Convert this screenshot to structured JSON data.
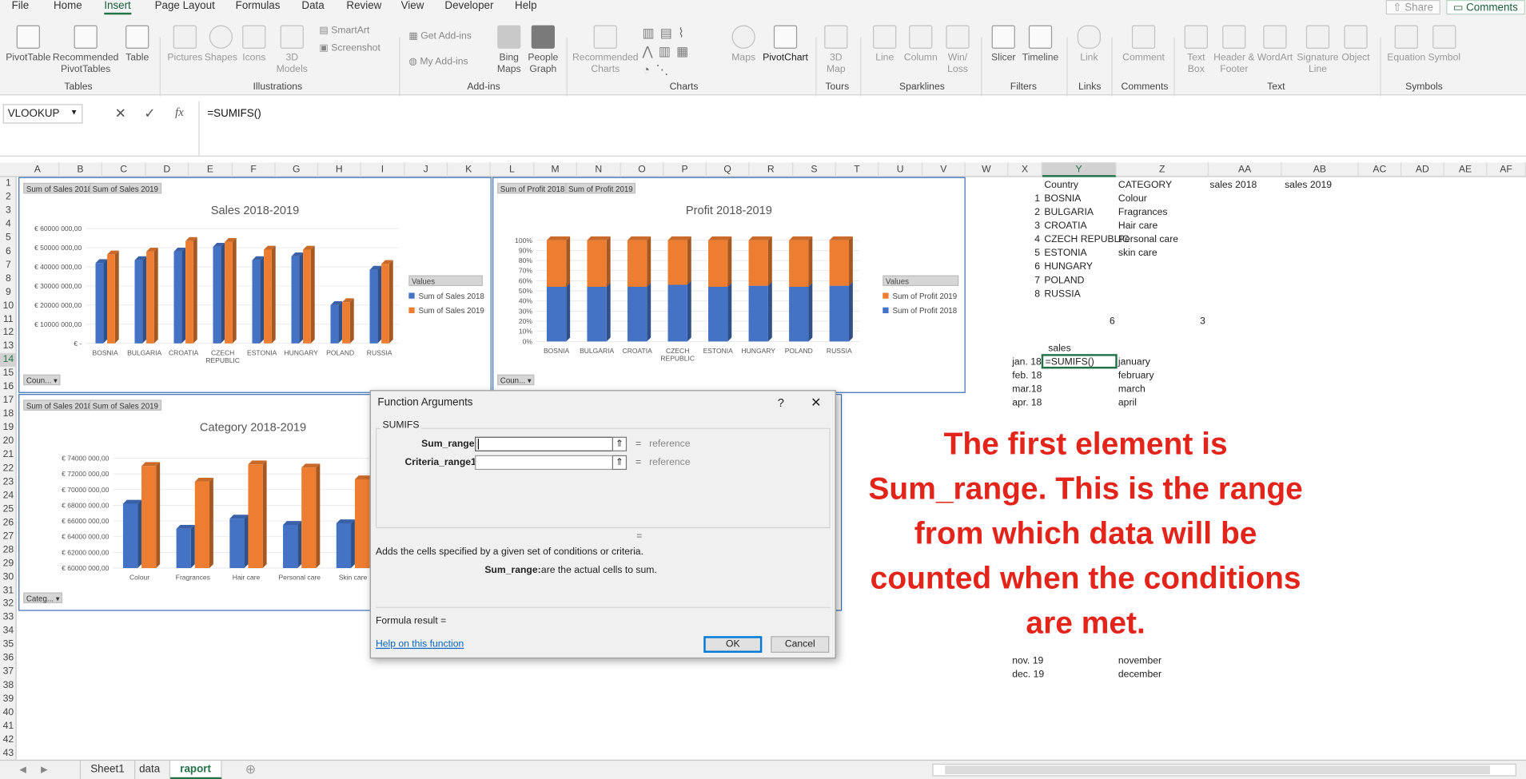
{
  "ribbon": {
    "tabs": [
      "File",
      "Home",
      "Insert",
      "Page Layout",
      "Formulas",
      "Data",
      "Review",
      "View",
      "Developer",
      "Help"
    ],
    "active_tab": "Insert",
    "share": "Share",
    "comments": "Comments",
    "buttons": {
      "pivottable": "PivotTable",
      "recommended_pivot": "Recommended PivotTables",
      "table": "Table",
      "pictures": "Pictures",
      "shapes": "Shapes",
      "icons": "Icons",
      "models_3d": "3D Models",
      "smartart": "SmartArt",
      "screenshot": "Screenshot",
      "get_addins": "Get Add-ins",
      "my_addins": "My Add-ins",
      "bing_maps": "Bing Maps",
      "people_graph": "People Graph",
      "recommended_charts": "Recommended Charts",
      "maps": "Maps",
      "pivotchart": "PivotChart",
      "map_3d": "3D Map",
      "line": "Line",
      "column": "Column",
      "winloss": "Win/ Loss",
      "slicer": "Slicer",
      "timeline": "Timeline",
      "link": "Link",
      "comment": "Comment",
      "textbox": "Text Box",
      "header_footer": "Header & Footer",
      "wordart": "WordArt",
      "signature": "Signature Line",
      "object": "Object",
      "equation": "Equation",
      "symbol": "Symbol"
    },
    "groups": [
      "Tables",
      "Illustrations",
      "Add-ins",
      "Charts",
      "Tours",
      "Sparklines",
      "Filters",
      "Links",
      "Comments",
      "Text",
      "Symbols"
    ]
  },
  "formula_bar": {
    "name_box": "VLOOKUP",
    "formula": "=SUMIFS()"
  },
  "columns": [
    "A",
    "B",
    "C",
    "D",
    "E",
    "F",
    "G",
    "H",
    "I",
    "J",
    "K",
    "L",
    "M",
    "N",
    "O",
    "P",
    "Q",
    "R",
    "S",
    "T",
    "U",
    "V",
    "W",
    "X",
    "Y",
    "Z",
    "AA",
    "AB",
    "AC",
    "AD",
    "AE",
    "AF"
  ],
  "rows": [
    "1",
    "2",
    "3",
    "4",
    "5",
    "6",
    "7",
    "8",
    "9",
    "10",
    "11",
    "12",
    "13",
    "14",
    "15",
    "16",
    "17",
    "18",
    "19",
    "20",
    "21",
    "22",
    "23",
    "24",
    "25",
    "26",
    "27",
    "28",
    "29",
    "30",
    "31",
    "32",
    "33",
    "34",
    "35",
    "36",
    "37",
    "38",
    "39",
    "40",
    "41",
    "42",
    "43"
  ],
  "sheet": {
    "header_country": "Country",
    "header_category": "CATEGORY",
    "header_sales2018": "sales 2018",
    "header_sales2019": "sales 2019",
    "numbers": [
      "1",
      "2",
      "3",
      "4",
      "5",
      "6",
      "7",
      "8"
    ],
    "countries": [
      "BOSNIA",
      "BULGARIA",
      "CROATIA",
      "CZECH REPUBLIC",
      "ESTONIA",
      "HUNGARY",
      "POLAND",
      "RUSSIA"
    ],
    "categories": [
      "Colour",
      "Fragrances",
      "Hair care",
      "Personal care",
      "skin care"
    ],
    "count_left": "6",
    "count_right": "3",
    "sales_label": "sales",
    "dates": [
      "jan. 18",
      "feb. 18",
      "mar.18",
      "apr. 18"
    ],
    "months": [
      "january",
      "february",
      "march",
      "april"
    ],
    "active_cell": "=SUMIFS()",
    "dates_bottom": [
      "nov. 19",
      "dec. 19"
    ],
    "months_bottom": [
      "november",
      "december"
    ]
  },
  "charts": {
    "sales": {
      "btn1": "Sum of Sales 2018",
      "btn2": "Sum of Sales 2019",
      "title": "Sales 2018-2019",
      "legend_title": "Values",
      "legend": [
        "Sum of Sales 2018",
        "Sum of Sales 2019"
      ],
      "filter": "Coun..."
    },
    "profit": {
      "btn1": "Sum of Profit 2018",
      "btn2": "Sum of Profit 2019",
      "title": "Profit 2018-2019",
      "legend_title": "Values",
      "legend": [
        "Sum of Profit 2019",
        "Sum of Profit 2018"
      ],
      "filter": "Coun..."
    },
    "category": {
      "btn1": "Sum of Sales 2018",
      "btn2": "Sum of Sales 2019",
      "title": "Category 2018-2019",
      "filter": "Categ..."
    }
  },
  "chart_data": [
    {
      "type": "bar",
      "title": "Sales 2018-2019",
      "categories": [
        "BOSNIA",
        "BULGARIA",
        "CROATIA",
        "CZECH REPUBLIC",
        "ESTONIA",
        "HUNGARY",
        "POLAND",
        "RUSSIA"
      ],
      "series": [
        {
          "name": "Sum of Sales 2018",
          "values": [
            42000000,
            43500000,
            48000000,
            50500000,
            43500000,
            45500000,
            20000000,
            38500000
          ]
        },
        {
          "name": "Sum of Sales 2019",
          "values": [
            46500000,
            48000000,
            53500000,
            53000000,
            49000000,
            49000000,
            21500000,
            41500000
          ]
        }
      ],
      "yticks": [
        "€ 60000 000,00",
        "€ 50000 000,00",
        "€ 40000 000,00",
        "€ 30000 000,00",
        "€ 20000 000,00",
        "€ 10000 000,00",
        "€ -"
      ],
      "ylim": [
        0,
        60000000
      ],
      "legend_position": "right",
      "colors": [
        "#4472c4",
        "#ed7d31"
      ]
    },
    {
      "type": "bar",
      "title": "Profit 2018-2019",
      "categories": [
        "BOSNIA",
        "BULGARIA",
        "CROATIA",
        "CZECH REPUBLIC",
        "ESTONIA",
        "HUNGARY",
        "POLAND",
        "RUSSIA"
      ],
      "stacked_percent": true,
      "series": [
        {
          "name": "Sum of Profit 2018",
          "values": [
            54,
            54,
            54,
            56,
            54,
            55,
            54,
            55
          ]
        },
        {
          "name": "Sum of Profit 2019",
          "values": [
            46,
            46,
            46,
            44,
            46,
            45,
            46,
            45
          ]
        }
      ],
      "yticks": [
        "100%",
        "90%",
        "80%",
        "70%",
        "60%",
        "50%",
        "40%",
        "30%",
        "20%",
        "10%",
        "0%"
      ],
      "ylim": [
        0,
        100
      ],
      "legend_position": "right",
      "colors": [
        "#4472c4",
        "#ed7d31"
      ]
    },
    {
      "type": "bar",
      "title": "Category 2018-2019",
      "categories": [
        "Colour",
        "Fragrances",
        "Hair care",
        "Personal care",
        "Skin care"
      ],
      "series": [
        {
          "name": "Sum of Sales 2018",
          "values": [
            68200000,
            65000000,
            66300000,
            65500000,
            65700000
          ]
        },
        {
          "name": "Sum of Sales 2019",
          "values": [
            73000000,
            71000000,
            73200000,
            72800000,
            71300000
          ]
        }
      ],
      "yticks": [
        "€ 74000 000,00",
        "€ 72000 000,00",
        "€ 70000 000,00",
        "€ 68000 000,00",
        "€ 66000 000,00",
        "€ 64000 000,00",
        "€ 62000 000,00",
        "€ 60000 000,00"
      ],
      "ylim": [
        60000000,
        74000000
      ],
      "colors": [
        "#4472c4",
        "#ed7d31"
      ]
    }
  ],
  "dialog": {
    "title": "Function Arguments",
    "help": "?",
    "close": "✕",
    "function_name": "SUMIFS",
    "arg1_label": "Sum_range",
    "arg2_label": "Criteria_range1",
    "eq": "=",
    "ref1": "reference",
    "ref2": "reference",
    "eq_mid": "=",
    "description": "Adds the cells specified by a given set of conditions or criteria.",
    "arg_help_name": "Sum_range:",
    "arg_help_text": "are the actual cells to sum.",
    "formula_result": "Formula result =",
    "help_link": "Help on this function",
    "ok": "OK",
    "cancel": "Cancel"
  },
  "sheet_tabs": [
    "Sheet1",
    "data",
    "raport"
  ],
  "active_sheet": "raport",
  "annotation": "The first element is Sum_range. This is the range from which data will be counted when the conditions are met."
}
